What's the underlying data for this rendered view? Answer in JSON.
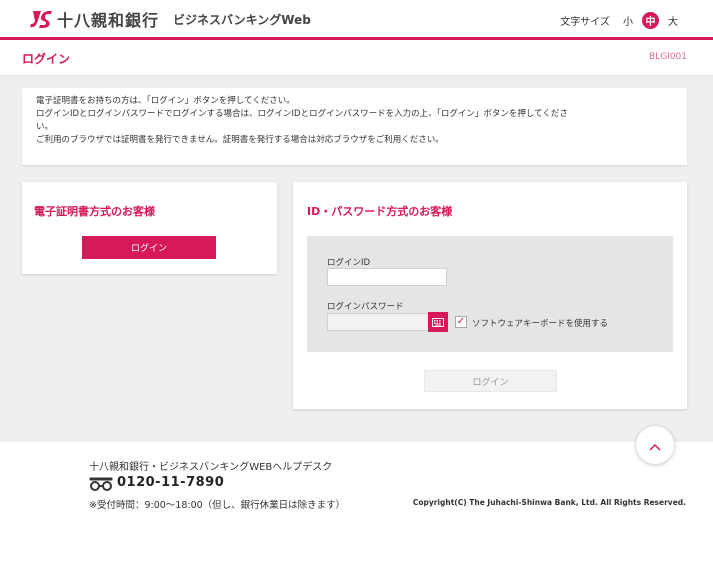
{
  "header": {
    "bank_name": "十八親和銀行",
    "service_name": "ビジネスバンキングWeb",
    "font_size_label": "文字サイズ",
    "font_sizes": [
      "小",
      "中",
      "大"
    ],
    "selected_font_size": "中"
  },
  "title_bar": {
    "title": "ログイン",
    "screen_id": "BLGI001"
  },
  "notice": {
    "lines": [
      "電子証明書をお持ちの方は、「ログイン」ボタンを押してください。",
      "ログインIDとログインパスワードでログインする場合は、ログインIDとログインパスワードを入力の上、「ログイン」ボタンを押してくださ",
      "い。",
      "ご利用のブラウザでは証明書を発行できません。証明書を発行する場合は対応ブラウザをご利用ください。"
    ]
  },
  "cert_card": {
    "title": "電子証明書方式のお客様",
    "login_button": "ログイン"
  },
  "id_card": {
    "title": "ID・パスワード方式のお客様",
    "id_label": "ログインID",
    "id_value": "",
    "password_label": "ログインパスワード",
    "password_value": "",
    "software_keyboard_label": "ソフトウェアキーボードを使用する",
    "software_keyboard_checked": true,
    "login_button": "ログイン"
  },
  "footer": {
    "helpdesk": "十八親和銀行・ビジネスバンキングWEBヘルプデスク",
    "phone": "0120-11-7890",
    "hours": "※受付時間：9:00～18:00（但し、銀行休業日は除きます）",
    "copyright": "Copyright(C) The Juhachi-Shinwa Bank, Ltd. All Rights Reserved."
  },
  "colors": {
    "brand": "#d7185a",
    "background": "#efefef"
  },
  "icons": {
    "logo": "js-logo-mark",
    "keyboard": "keyboard-icon",
    "freedial": "freedial-icon",
    "scroll_top": "chevron-up-icon"
  }
}
